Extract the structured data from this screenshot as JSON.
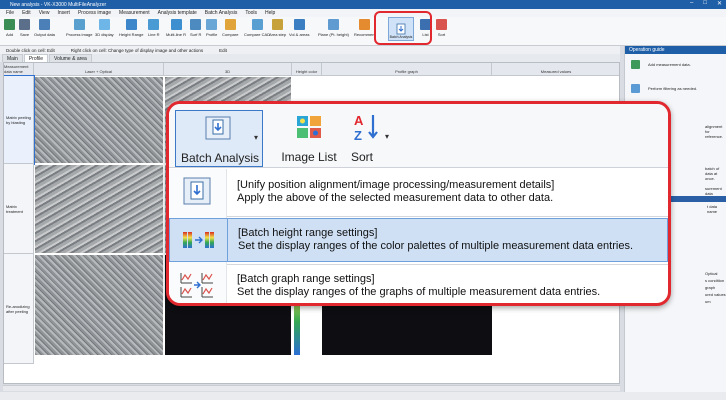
{
  "window": {
    "title": "New analysis - VK-X3000 MultiFileAnalyzer",
    "controls": [
      "–",
      "□",
      "✕"
    ]
  },
  "menu": [
    "File",
    "Edit",
    "View",
    "Insert",
    "Process image",
    "Measurement",
    "Analysis template",
    "Batch Analysis",
    "Tools",
    "Help"
  ],
  "ribbon": {
    "buttons": [
      "Add",
      "Save",
      "Output data",
      "Process image",
      "3D display",
      "Height Range",
      "Line R",
      "Multi-line R",
      "Surf R",
      "Profile",
      "Compare",
      "Compare CAD",
      "Area step",
      "Vol & areas",
      "Plane (Pt. height)",
      "Recomment",
      "Batch Analysis",
      "List",
      "Sort"
    ]
  },
  "hints": [
    "Double click on cell: Edit",
    "Right click on cell: Change type of display image and other actions",
    "Edit"
  ],
  "sheet_tabs": [
    "Main",
    "Profile",
    "Volume & area"
  ],
  "grid": {
    "headers": [
      "Measurement data name",
      "Laser + Optical",
      "3D",
      "Height color",
      "Profile graph",
      "Measured values"
    ],
    "rows": [
      "Matrix peeling by blasting",
      "Matrix treatment",
      "Re-anodizing after peeling"
    ]
  },
  "op_guide": {
    "title": "Operation guide",
    "items": [
      "Add measurement data.",
      "Perform filtering as needed.",
      "alignment for reference.",
      "batch of data at once.",
      "surement data",
      "t data name",
      "ptical",
      "Optical",
      "s condition",
      "graph",
      "ured values",
      "um"
    ]
  },
  "popup": {
    "toolbar": [
      {
        "label": "Batch Analysis",
        "active": true
      },
      {
        "label": "Image List",
        "active": false
      },
      {
        "label": "Sort",
        "active": false
      }
    ],
    "entries": [
      {
        "title": "[Unify position alignment/image processing/measurement details]",
        "desc": "Apply the above of the selected measurement data to other data.",
        "highlighted": false
      },
      {
        "title": "[Batch height range settings]",
        "desc": "Set the display ranges of the color palettes of multiple measurement data entries.",
        "highlighted": true
      },
      {
        "title": "[Batch graph range settings]",
        "desc": "Set the display ranges of the graphs of multiple measurement data entries.",
        "highlighted": false
      }
    ]
  },
  "colors": {
    "accent": "#1f5fa8",
    "callout": "#e0282e",
    "highlight": "#cfe0f5"
  }
}
